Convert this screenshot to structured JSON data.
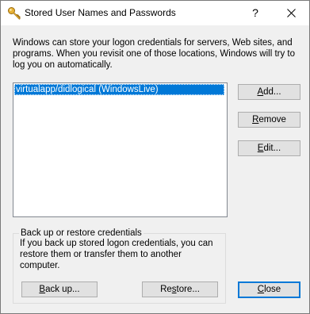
{
  "window": {
    "title": "Stored User Names and Passwords",
    "help_glyph": "?",
    "title_icon": "key-icon",
    "close_icon": "close-icon"
  },
  "intro_text": "Windows can store your logon credentials for servers, Web sites, and programs. When you revisit one of those locations, Windows will try to log you on automatically.",
  "credentials": {
    "items": [
      {
        "label": "virtualapp/didlogical (WindowsLive)",
        "selected": true
      }
    ]
  },
  "buttons": {
    "add": {
      "mnemonic": "A",
      "rest": "dd..."
    },
    "remove": {
      "mnemonic": "R",
      "rest": "emove"
    },
    "edit": {
      "mnemonic": "E",
      "rest": "dit..."
    },
    "backup": {
      "mnemonic": "B",
      "rest": "ack up..."
    },
    "restore": {
      "pre": "Re",
      "mnemonic": "s",
      "rest": "tore..."
    },
    "close": {
      "mnemonic": "C",
      "rest": "lose"
    }
  },
  "backup_group": {
    "legend": "Back up or restore credentials",
    "description": "If you back up stored logon credentials, you can restore them or transfer them to another computer."
  },
  "colors": {
    "selection": "#0078d7",
    "dialog_background": "#f0f0f0",
    "button_face": "#e1e1e1"
  }
}
